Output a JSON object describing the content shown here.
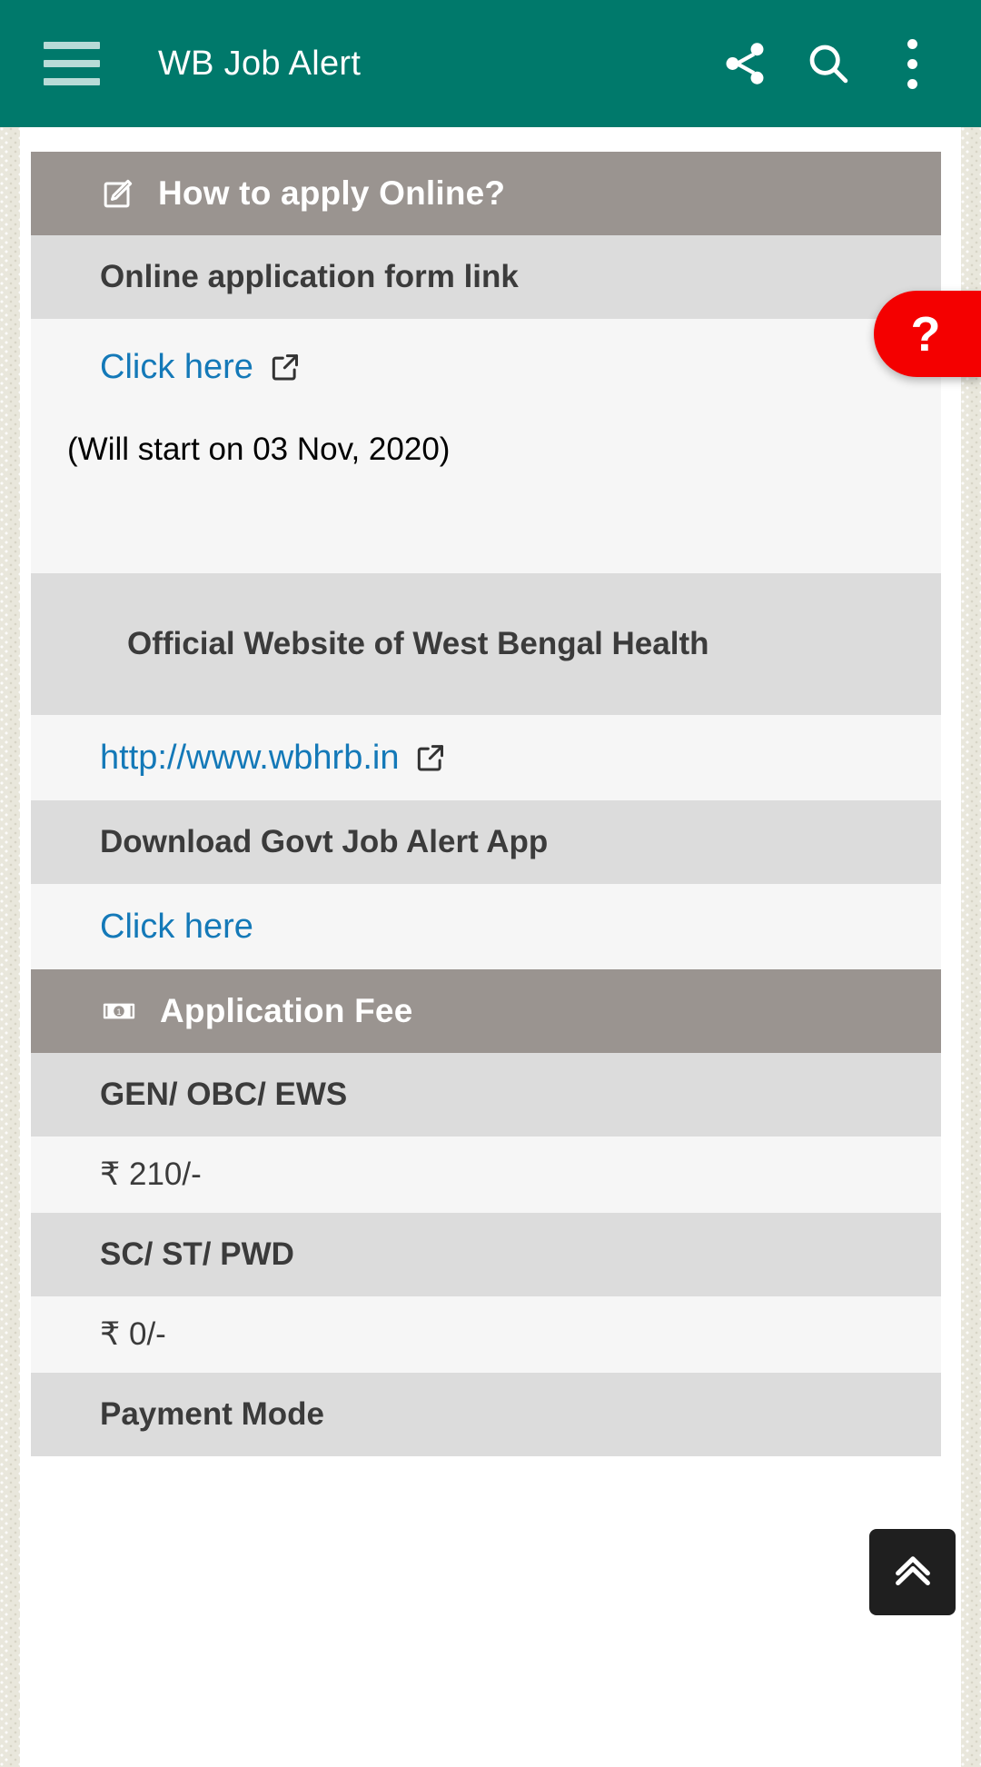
{
  "appbar": {
    "title": "WB Job Alert",
    "menu_icon": "hamburger-menu-icon",
    "share_icon": "share-icon",
    "search_icon": "search-icon",
    "overflow_icon": "overflow-menu-icon",
    "background_color": "#00796b"
  },
  "floating": {
    "help_label": "?",
    "help_color": "#f40000",
    "scroll_top_icon": "double-chevron-up-icon",
    "scroll_top_color": "#1f1f1f"
  },
  "sections": [
    {
      "type": "header",
      "icon": "edit-pencil-icon",
      "title": "How to apply Online?"
    },
    {
      "type": "sub",
      "label": "Online application form link"
    },
    {
      "type": "link",
      "label": "Click here",
      "external_icon": "external-link-icon"
    },
    {
      "type": "note",
      "text": "(Will start on 03 Nov, 2020)"
    },
    {
      "type": "sub-two-line",
      "label": "Official Website of West Bengal Health"
    },
    {
      "type": "link",
      "label": "http://www.wbhrb.in",
      "external_icon": "external-link-icon"
    },
    {
      "type": "sub",
      "label": "Download Govt Job Alert App"
    },
    {
      "type": "link-plain",
      "label": "Click here"
    },
    {
      "type": "header",
      "icon": "money-bill-icon",
      "title": "Application Fee"
    },
    {
      "type": "sub",
      "label": "GEN/ OBC/ EWS"
    },
    {
      "type": "value",
      "text": "₹ 210/-"
    },
    {
      "type": "sub",
      "label": "SC/ ST/ PWD"
    },
    {
      "type": "value",
      "text": "₹ 0/-"
    },
    {
      "type": "sub",
      "label": "Payment Mode"
    }
  ],
  "colors": {
    "header_row": "#9a9490",
    "sub_row": "#dcdcdc",
    "value_row": "#f6f6f6",
    "link": "#1479b8",
    "text": "#3b3b3b"
  }
}
